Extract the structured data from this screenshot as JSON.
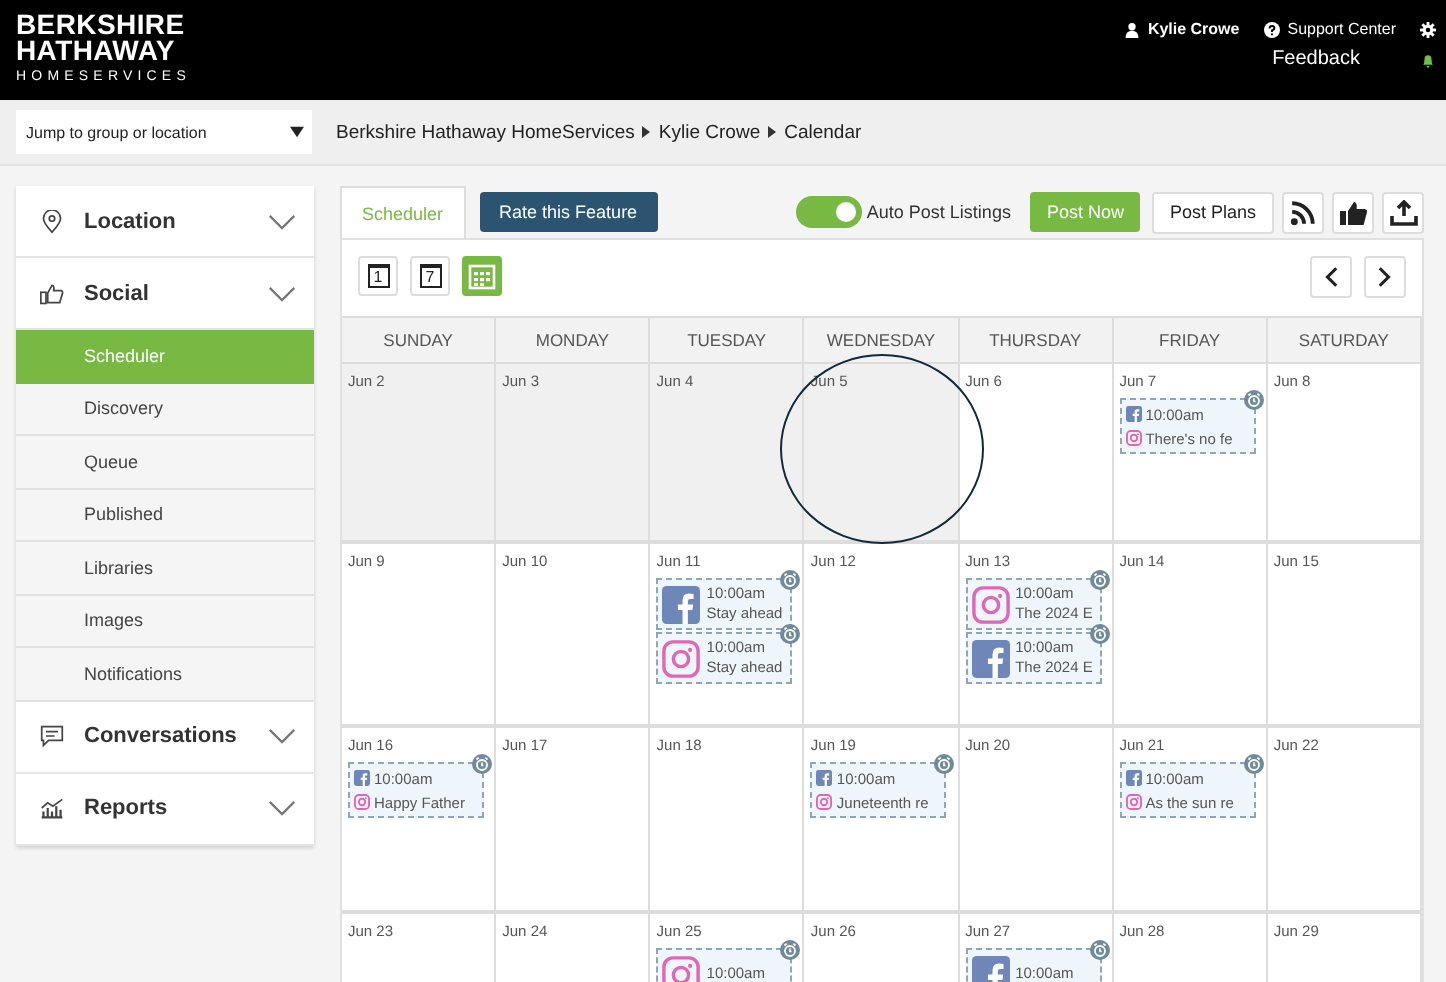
{
  "header": {
    "logo": [
      "BERKSHIRE",
      "HATHAWAY",
      "HOMESERVICES"
    ],
    "user": "Kylie Crowe",
    "support": "Support Center",
    "feedback": "Feedback"
  },
  "location_select": {
    "value": "Jump to group or location"
  },
  "breadcrumb": [
    "Berkshire Hathaway HomeServices",
    "Kylie Crowe",
    "Calendar"
  ],
  "sidebar": {
    "items": [
      {
        "kind": "location",
        "label": "Location",
        "expanded": false
      },
      {
        "kind": "social",
        "label": "Social",
        "expanded": true,
        "children": [
          {
            "label": "Scheduler",
            "selected": true
          },
          {
            "label": "Discovery",
            "selected": false
          },
          {
            "label": "Queue",
            "selected": false
          },
          {
            "label": "Published",
            "selected": false
          },
          {
            "label": "Libraries",
            "selected": false
          },
          {
            "label": "Images",
            "selected": false
          },
          {
            "label": "Notifications",
            "selected": false
          }
        ]
      },
      {
        "kind": "conversations",
        "label": "Conversations",
        "expanded": false
      },
      {
        "kind": "reports",
        "label": "Reports",
        "expanded": false
      }
    ]
  },
  "tabs": [
    {
      "label": "Scheduler",
      "selected": true
    }
  ],
  "rate_button": "Rate this Feature",
  "auto_post": {
    "label": "Auto Post Listings",
    "on": true
  },
  "post_now": "Post Now",
  "post_plans": "Post Plans",
  "views": [
    {
      "kind": "day",
      "number": "1",
      "selected": false
    },
    {
      "kind": "week",
      "number": "7",
      "selected": false
    },
    {
      "kind": "month",
      "selected": true
    }
  ],
  "calendar": {
    "weekdays": [
      "SUNDAY",
      "MONDAY",
      "TUESDAY",
      "WEDNESDAY",
      "THURSDAY",
      "FRIDAY",
      "SATURDAY"
    ],
    "weeks": [
      [
        {
          "date": "Jun 2",
          "past": true
        },
        {
          "date": "Jun 3",
          "past": true
        },
        {
          "date": "Jun 4",
          "past": true
        },
        {
          "date": "Jun 5",
          "past": true,
          "circled": true
        },
        {
          "date": "Jun 6",
          "past": false
        },
        {
          "date": "Jun 7",
          "past": false,
          "posts": [
            {
              "kind": "pair",
              "time": "10:00am",
              "text": "There's no fe"
            }
          ]
        },
        {
          "date": "Jun 8",
          "past": false
        }
      ],
      [
        {
          "date": "Jun 9",
          "past": false
        },
        {
          "date": "Jun 10",
          "past": false
        },
        {
          "date": "Jun 11",
          "past": false,
          "posts": [
            {
              "kind": "facebook",
              "time": "10:00am",
              "text": "Stay ahead"
            },
            {
              "kind": "instagram",
              "time": "10:00am",
              "text": "Stay ahead"
            }
          ]
        },
        {
          "date": "Jun 12",
          "past": false
        },
        {
          "date": "Jun 13",
          "past": false,
          "posts": [
            {
              "kind": "instagram",
              "time": "10:00am",
              "text": "The 2024 E"
            },
            {
              "kind": "facebook",
              "time": "10:00am",
              "text": "The 2024 E"
            }
          ]
        },
        {
          "date": "Jun 14",
          "past": false
        },
        {
          "date": "Jun 15",
          "past": false
        }
      ],
      [
        {
          "date": "Jun 16",
          "past": false,
          "posts": [
            {
              "kind": "pair",
              "time": "10:00am",
              "text": "Happy Father"
            }
          ]
        },
        {
          "date": "Jun 17",
          "past": false
        },
        {
          "date": "Jun 18",
          "past": false
        },
        {
          "date": "Jun 19",
          "past": false,
          "posts": [
            {
              "kind": "pair",
              "time": "10:00am",
              "text": "Juneteenth re"
            }
          ]
        },
        {
          "date": "Jun 20",
          "past": false
        },
        {
          "date": "Jun 21",
          "past": false,
          "posts": [
            {
              "kind": "pair",
              "time": "10:00am",
              "text": "As the sun re"
            }
          ]
        },
        {
          "date": "Jun 22",
          "past": false
        }
      ],
      [
        {
          "date": "Jun 23",
          "past": false
        },
        {
          "date": "Jun 24",
          "past": false
        },
        {
          "date": "Jun 25",
          "past": false,
          "posts": [
            {
              "kind": "instagram",
              "time": "10:00am"
            }
          ]
        },
        {
          "date": "Jun 26",
          "past": false
        },
        {
          "date": "Jun 27",
          "past": false,
          "posts": [
            {
              "kind": "facebook",
              "time": "10:00am"
            }
          ]
        },
        {
          "date": "Jun 28",
          "past": false
        },
        {
          "date": "Jun 29",
          "past": false
        }
      ]
    ]
  }
}
